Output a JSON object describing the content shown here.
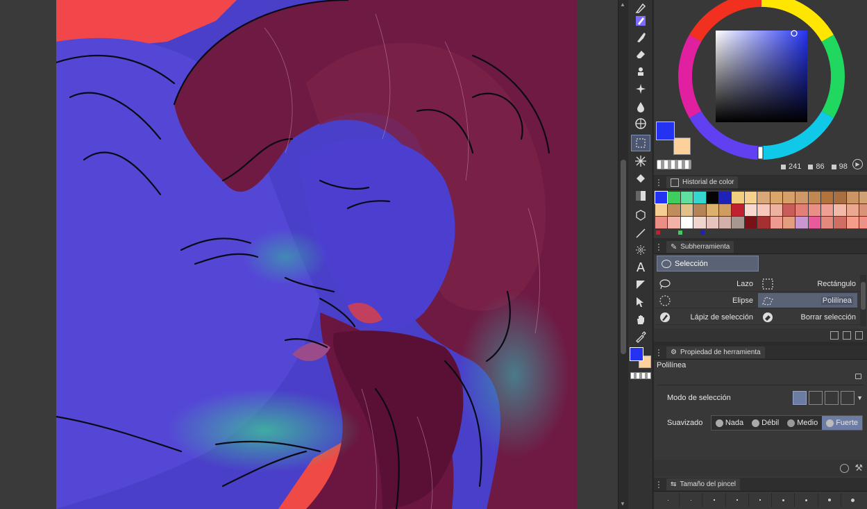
{
  "color": {
    "main": "#2433f2",
    "sub": "#ffd19a",
    "h": "241",
    "s": "86",
    "v": "98"
  },
  "history_panel": {
    "title": "Historial de color",
    "swatches": [
      "#2433f2",
      "#3fce5e",
      "#5fe0a0",
      "#35d6cf",
      "#050505",
      "#1e22b6",
      "#f2cf7e",
      "#f5d08e",
      "#d8a878",
      "#dba66b",
      "#d6a06a",
      "#cf9868",
      "#c18752",
      "#b3733f",
      "#a96f42",
      "#cb9566",
      "#d2a172",
      "#f5cc92",
      "#c08c5c",
      "#e2c089",
      "#b48458",
      "#dcb16e",
      "#d09c62",
      "#c0202f",
      "#f9d9cf",
      "#f7c7bc",
      "#efb19f",
      "#c85d5a",
      "#e37f77",
      "#ea8f85",
      "#ef9f94",
      "#f2b9a8",
      "#e9a88f",
      "#d79277",
      "#ea8e86",
      "#f1b2a7",
      "#ffffff",
      "#f0d5cf",
      "#e6c4bd",
      "#d4b0aa",
      "#a89691",
      "#7a1117",
      "#a43031",
      "#ed9b8f",
      "#e39e7f",
      "#c897d0",
      "#e75a9b",
      "#e5897f",
      "#d06e64",
      "#f59c8a",
      "#f48f83"
    ]
  },
  "subtool_panel": {
    "title": "Subherramienta",
    "group": "Selección",
    "items": {
      "lazo": "Lazo",
      "rectangulo": "Rectángulo",
      "elipse": "Elipse",
      "polilinea": "Polilínea",
      "lapiz": "Lápiz de selección",
      "borrar": "Borrar selección"
    }
  },
  "property_panel": {
    "title": "Propiedad de herramienta",
    "tool_name": "Polilínea",
    "selection_mode_label": "Modo de selección",
    "smoothing_label": "Suavizado",
    "smoothing_options": [
      "Nada",
      "Débil",
      "Medio",
      "Fuerte"
    ],
    "smoothing_selected": "Fuerte"
  },
  "brush_panel": {
    "title": "Tamaño del pincel"
  }
}
